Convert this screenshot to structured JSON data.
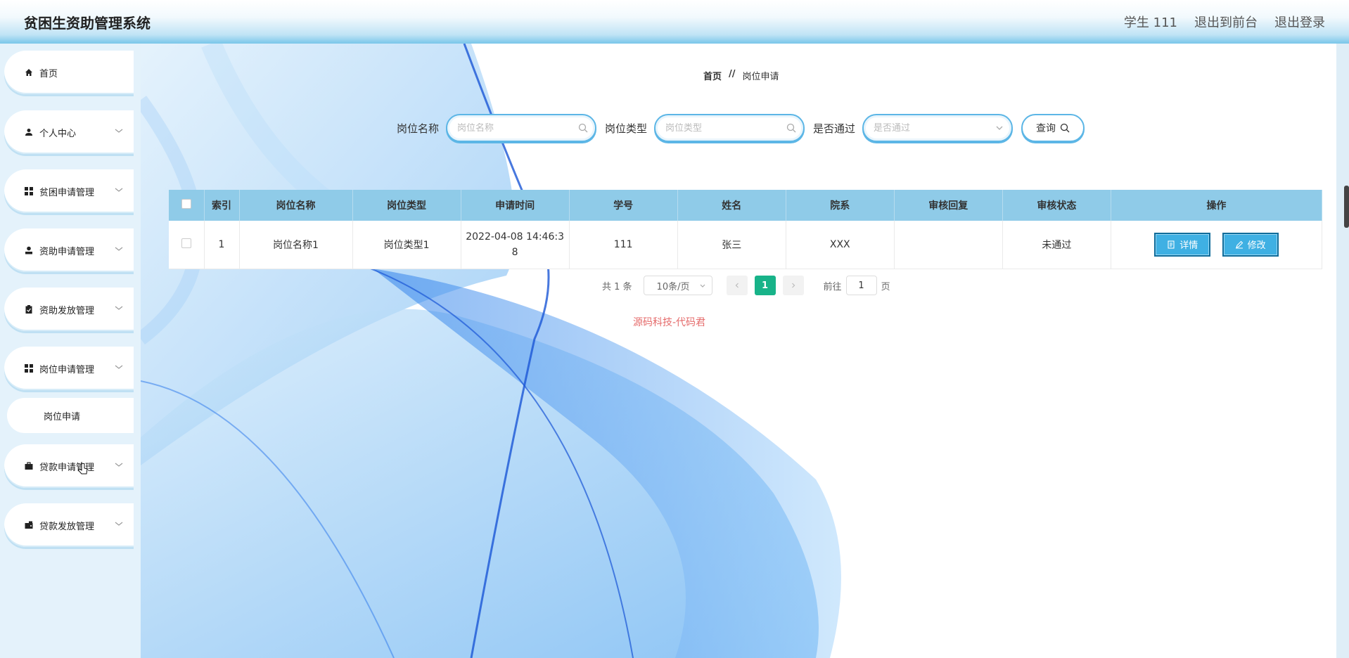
{
  "app": {
    "title": "贫困生资助管理系统"
  },
  "header": {
    "user": "学生 111",
    "front_link": "退出到前台",
    "logout": "退出登录"
  },
  "sidebar": {
    "items": [
      {
        "label": "首页",
        "icon": "home-icon",
        "has_children": false
      },
      {
        "label": "个人中心",
        "icon": "user-icon",
        "has_children": true
      },
      {
        "label": "贫困申请管理",
        "icon": "grid-icon",
        "has_children": true
      },
      {
        "label": "资助申请管理",
        "icon": "user-alt-icon",
        "has_children": true
      },
      {
        "label": "资助发放管理",
        "icon": "clipboard-icon",
        "has_children": true
      },
      {
        "label": "岗位申请管理",
        "icon": "grid-icon",
        "has_children": true
      },
      {
        "label": "贷款申请管理",
        "icon": "briefcase-icon",
        "has_children": true
      },
      {
        "label": "贷款发放管理",
        "icon": "wallet-icon",
        "has_children": true
      }
    ],
    "submenu": {
      "label": "岗位申请"
    }
  },
  "breadcrumb": {
    "home": "首页",
    "separator": "//",
    "current": "岗位申请"
  },
  "search": {
    "name_label": "岗位名称",
    "name_placeholder": "岗位名称",
    "type_label": "岗位类型",
    "type_placeholder": "岗位类型",
    "passed_label": "是否通过",
    "passed_placeholder": "是否通过",
    "query_label": "查询"
  },
  "table": {
    "headers": [
      "索引",
      "岗位名称",
      "岗位类型",
      "申请时间",
      "学号",
      "姓名",
      "院系",
      "审核回复",
      "审核状态",
      "操作"
    ],
    "rows": [
      {
        "index": "1",
        "name": "岗位名称1",
        "type": "岗位类型1",
        "time": "2022-04-08 14:46:3\n8",
        "student_no": "111",
        "student_name": "张三",
        "dept": "XXX",
        "reply": "",
        "status": "未通过"
      }
    ],
    "actions": {
      "detail": "详情",
      "edit": "修改"
    }
  },
  "pagination": {
    "total": "共 1 条",
    "page_size": "10条/页",
    "current_page": "1",
    "goto_label": "前往",
    "goto_value": "1",
    "page_suffix": "页"
  },
  "watermark": "源码科技-代码君",
  "colors": {
    "accent": "#5cb6e6",
    "header_bg": "#79c6ea",
    "table_header": "#8fcbe8",
    "active_page": "#18b389",
    "watermark": "#e56b6b"
  }
}
